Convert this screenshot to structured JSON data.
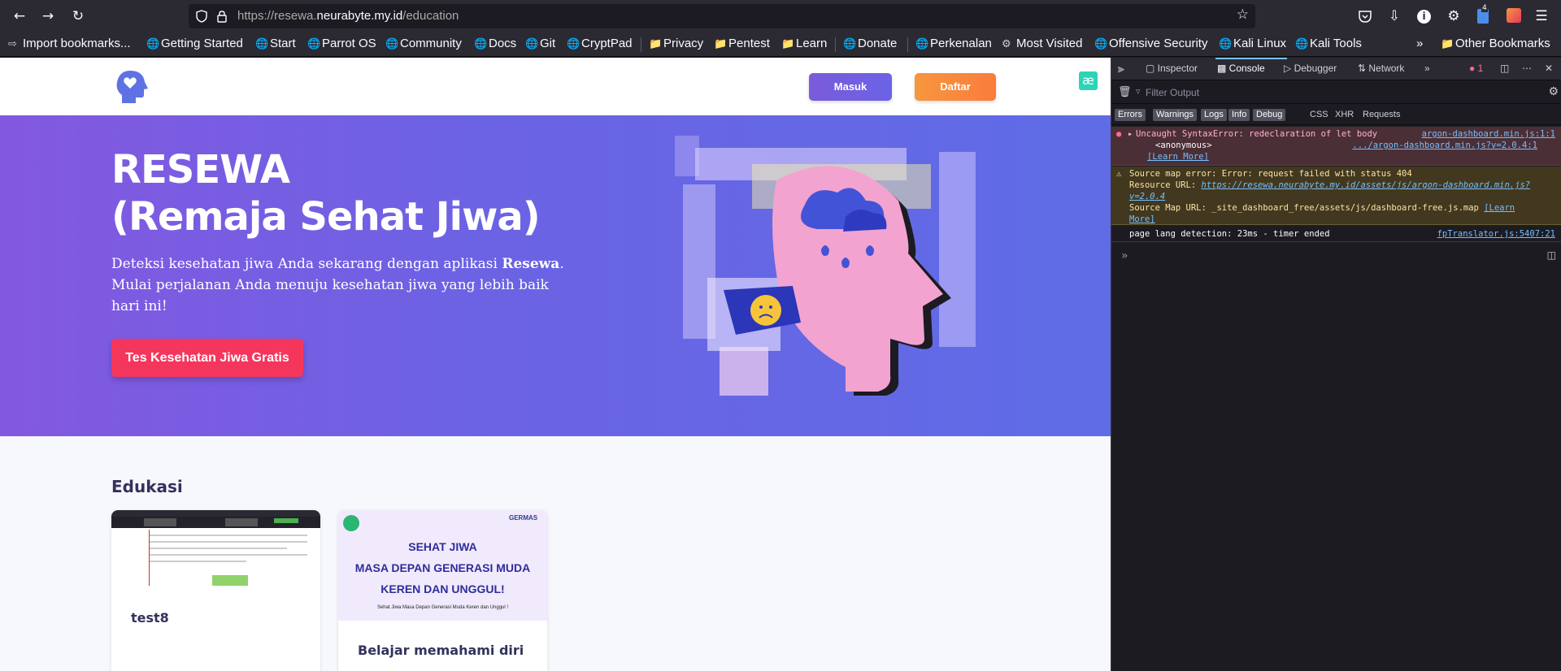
{
  "browser": {
    "url_prefix": "https://resewa.",
    "url_domain": "neurabyte.my.id",
    "url_path": "/education",
    "ext_badge_count": "4",
    "bookmarks": [
      "Import bookmarks...",
      "Getting Started",
      "Start",
      "Parrot OS",
      "Community",
      "Docs",
      "Git",
      "CryptPad",
      "Privacy",
      "Pentest",
      "Learn",
      "Donate",
      "Perkenalan",
      "Most Visited",
      "Offensive Security",
      "Kali Linux",
      "Kali Tools"
    ],
    "other_bookmarks": "Other Bookmarks"
  },
  "site": {
    "nav": {
      "login": "Masuk",
      "register": "Daftar"
    },
    "hero": {
      "title_line1": "RESEWA",
      "title_line2": "(Remaja Sehat Jiwa)",
      "desc_part1": "Deteksi kesehatan jiwa Anda sekarang dengan aplikasi ",
      "desc_bold": "Resewa",
      "desc_part2": ". Mulai perjalanan Anda menuju kesehatan jiwa yang lebih baik hari ini!",
      "cta": "Tes Kesehatan Jiwa Gratis"
    },
    "section_title": "Edukasi",
    "cards": [
      {
        "title": "test8"
      },
      {
        "title": "Belajar memahami diri",
        "poster_line1": "SEHAT JIWA",
        "poster_line2": "MASA DEPAN GENERASI MUDA",
        "poster_line3": "KEREN DAN UNGGUL!",
        "poster_sub": "Sehat Jiwa Masa Depan Generasi Muda Keren dan Unggul !",
        "poster_brand": "GERMAS"
      }
    ]
  },
  "devtools": {
    "tabs": {
      "inspector": "Inspector",
      "console": "Console",
      "debugger": "Debugger",
      "network": "Network"
    },
    "error_count": "1",
    "filter_placeholder": "Filter Output",
    "levels": [
      "Errors",
      "Warnings",
      "Logs",
      "Info",
      "Debug"
    ],
    "levels2": [
      "CSS",
      "XHR",
      "Requests"
    ],
    "messages": {
      "error_text": "Uncaught SyntaxError: redeclaration of let body",
      "error_src": "argon-dashboard.min.js:1:1",
      "error_frame": "<anonymous>",
      "error_frame_src": ".../argon-dashboard.min.js?v=2.0.4:1",
      "learn_more": "[Learn More]",
      "warn_line1": "Source map error: Error: request failed with status 404",
      "warn_resource_label": "Resource URL: ",
      "warn_resource_url1": "https://resewa.neurabyte.my.id/assets/js/argon-dashboard.min.js?",
      "warn_resource_url2": "v=2.0.4",
      "warn_map_line": "Source Map URL: _site_dashboard_free/assets/js/dashboard-free.js.map ",
      "warn_learn1": "[Learn",
      "warn_learn2": "More]",
      "log_text": "page lang detection: 23ms - timer ended",
      "log_src": "fpTranslator.js:5407:21"
    }
  }
}
